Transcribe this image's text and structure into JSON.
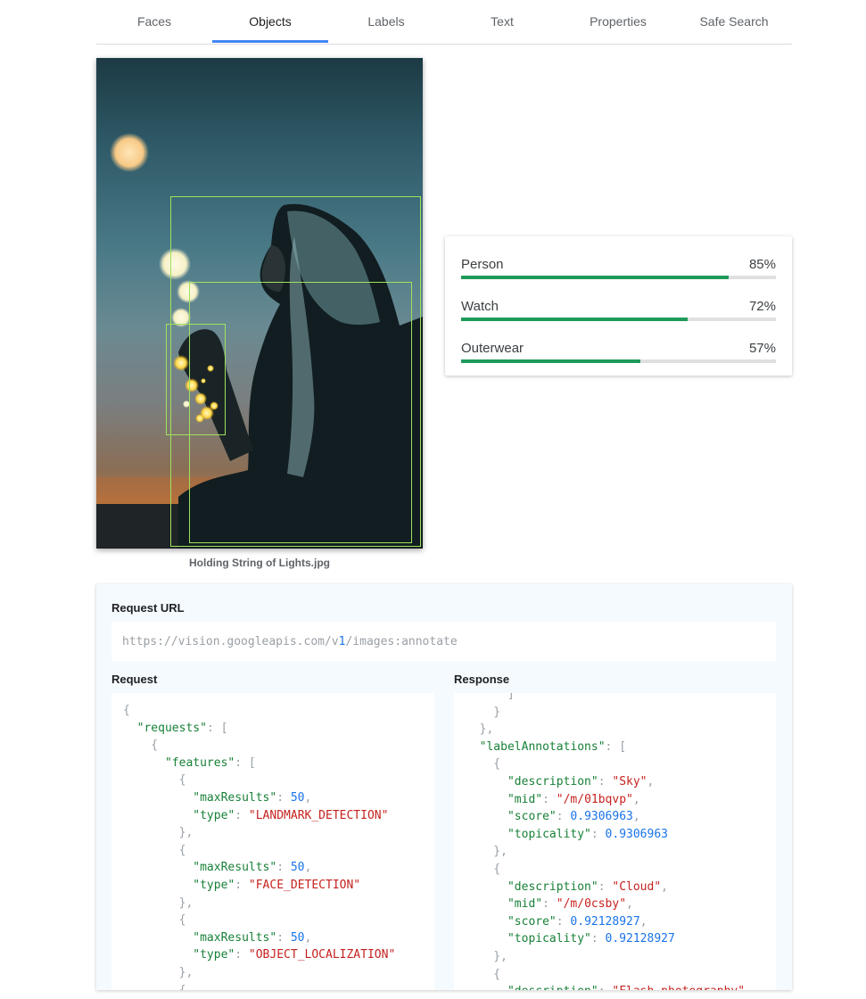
{
  "tabs": [
    {
      "label": "Faces",
      "active": false
    },
    {
      "label": "Objects",
      "active": true
    },
    {
      "label": "Labels",
      "active": false
    },
    {
      "label": "Text",
      "active": false
    },
    {
      "label": "Properties",
      "active": false
    },
    {
      "label": "Safe Search",
      "active": false
    }
  ],
  "image": {
    "caption": "Holding String of Lights.jpg"
  },
  "objects": [
    {
      "name": "Person",
      "percent_label": "85%",
      "score": 0.85
    },
    {
      "name": "Watch",
      "percent_label": "72%",
      "score": 0.72
    },
    {
      "name": "Outerwear",
      "percent_label": "57%",
      "score": 0.57
    }
  ],
  "colors": {
    "accent": "#4285f4",
    "bar_fill": "#1e9a5a",
    "bbox": "#9ee35c",
    "json_key": "#188038",
    "json_string": "#c5221f",
    "json_number": "#1a73e8"
  },
  "api": {
    "request_url_label": "Request URL",
    "url_prefix": "https://vision.googleapis.com/v",
    "url_highlight": "1",
    "url_suffix": "/images:annotate",
    "request_label": "Request",
    "response_label": "Response",
    "request_lines": [
      [
        [
          "p",
          "{"
        ]
      ],
      [
        [
          "p",
          "  "
        ],
        [
          "k",
          "\"requests\""
        ],
        [
          "p",
          ": ["
        ]
      ],
      [
        [
          "p",
          "    {"
        ]
      ],
      [
        [
          "p",
          "      "
        ],
        [
          "k",
          "\"features\""
        ],
        [
          "p",
          ": ["
        ]
      ],
      [
        [
          "p",
          "        {"
        ]
      ],
      [
        [
          "p",
          "          "
        ],
        [
          "k",
          "\"maxResults\""
        ],
        [
          "p",
          ": "
        ],
        [
          "n",
          "50"
        ],
        [
          "p",
          ","
        ]
      ],
      [
        [
          "p",
          "          "
        ],
        [
          "k",
          "\"type\""
        ],
        [
          "p",
          ": "
        ],
        [
          "s",
          "\"LANDMARK_DETECTION\""
        ]
      ],
      [
        [
          "p",
          "        },"
        ]
      ],
      [
        [
          "p",
          "        {"
        ]
      ],
      [
        [
          "p",
          "          "
        ],
        [
          "k",
          "\"maxResults\""
        ],
        [
          "p",
          ": "
        ],
        [
          "n",
          "50"
        ],
        [
          "p",
          ","
        ]
      ],
      [
        [
          "p",
          "          "
        ],
        [
          "k",
          "\"type\""
        ],
        [
          "p",
          ": "
        ],
        [
          "s",
          "\"FACE_DETECTION\""
        ]
      ],
      [
        [
          "p",
          "        },"
        ]
      ],
      [
        [
          "p",
          "        {"
        ]
      ],
      [
        [
          "p",
          "          "
        ],
        [
          "k",
          "\"maxResults\""
        ],
        [
          "p",
          ": "
        ],
        [
          "n",
          "50"
        ],
        [
          "p",
          ","
        ]
      ],
      [
        [
          "p",
          "          "
        ],
        [
          "k",
          "\"type\""
        ],
        [
          "p",
          ": "
        ],
        [
          "s",
          "\"OBJECT_LOCALIZATION\""
        ]
      ],
      [
        [
          "p",
          "        },"
        ]
      ],
      [
        [
          "p",
          "        {"
        ]
      ]
    ],
    "response_lines": [
      [
        [
          "p",
          "      ]"
        ]
      ],
      [
        [
          "p",
          "    }"
        ]
      ],
      [
        [
          "p",
          "  },"
        ]
      ],
      [
        [
          "p",
          "  "
        ],
        [
          "k",
          "\"labelAnnotations\""
        ],
        [
          "p",
          ": ["
        ]
      ],
      [
        [
          "p",
          "    {"
        ]
      ],
      [
        [
          "p",
          "      "
        ],
        [
          "k",
          "\"description\""
        ],
        [
          "p",
          ": "
        ],
        [
          "s",
          "\"Sky\""
        ],
        [
          "p",
          ","
        ]
      ],
      [
        [
          "p",
          "      "
        ],
        [
          "k",
          "\"mid\""
        ],
        [
          "p",
          ": "
        ],
        [
          "s",
          "\"/m/01bqvp\""
        ],
        [
          "p",
          ","
        ]
      ],
      [
        [
          "p",
          "      "
        ],
        [
          "k",
          "\"score\""
        ],
        [
          "p",
          ": "
        ],
        [
          "n",
          "0.9306963"
        ],
        [
          "p",
          ","
        ]
      ],
      [
        [
          "p",
          "      "
        ],
        [
          "k",
          "\"topicality\""
        ],
        [
          "p",
          ": "
        ],
        [
          "n",
          "0.9306963"
        ]
      ],
      [
        [
          "p",
          "    },"
        ]
      ],
      [
        [
          "p",
          "    {"
        ]
      ],
      [
        [
          "p",
          "      "
        ],
        [
          "k",
          "\"description\""
        ],
        [
          "p",
          ": "
        ],
        [
          "s",
          "\"Cloud\""
        ],
        [
          "p",
          ","
        ]
      ],
      [
        [
          "p",
          "      "
        ],
        [
          "k",
          "\"mid\""
        ],
        [
          "p",
          ": "
        ],
        [
          "s",
          "\"/m/0csby\""
        ],
        [
          "p",
          ","
        ]
      ],
      [
        [
          "p",
          "      "
        ],
        [
          "k",
          "\"score\""
        ],
        [
          "p",
          ": "
        ],
        [
          "n",
          "0.92128927"
        ],
        [
          "p",
          ","
        ]
      ],
      [
        [
          "p",
          "      "
        ],
        [
          "k",
          "\"topicality\""
        ],
        [
          "p",
          ": "
        ],
        [
          "n",
          "0.92128927"
        ]
      ],
      [
        [
          "p",
          "    },"
        ]
      ],
      [
        [
          "p",
          "    {"
        ]
      ],
      [
        [
          "p",
          "      "
        ],
        [
          "k",
          "\"description\""
        ],
        [
          "p",
          ": "
        ],
        [
          "s",
          "\"Flash photography\""
        ],
        [
          "p",
          ","
        ]
      ]
    ]
  }
}
